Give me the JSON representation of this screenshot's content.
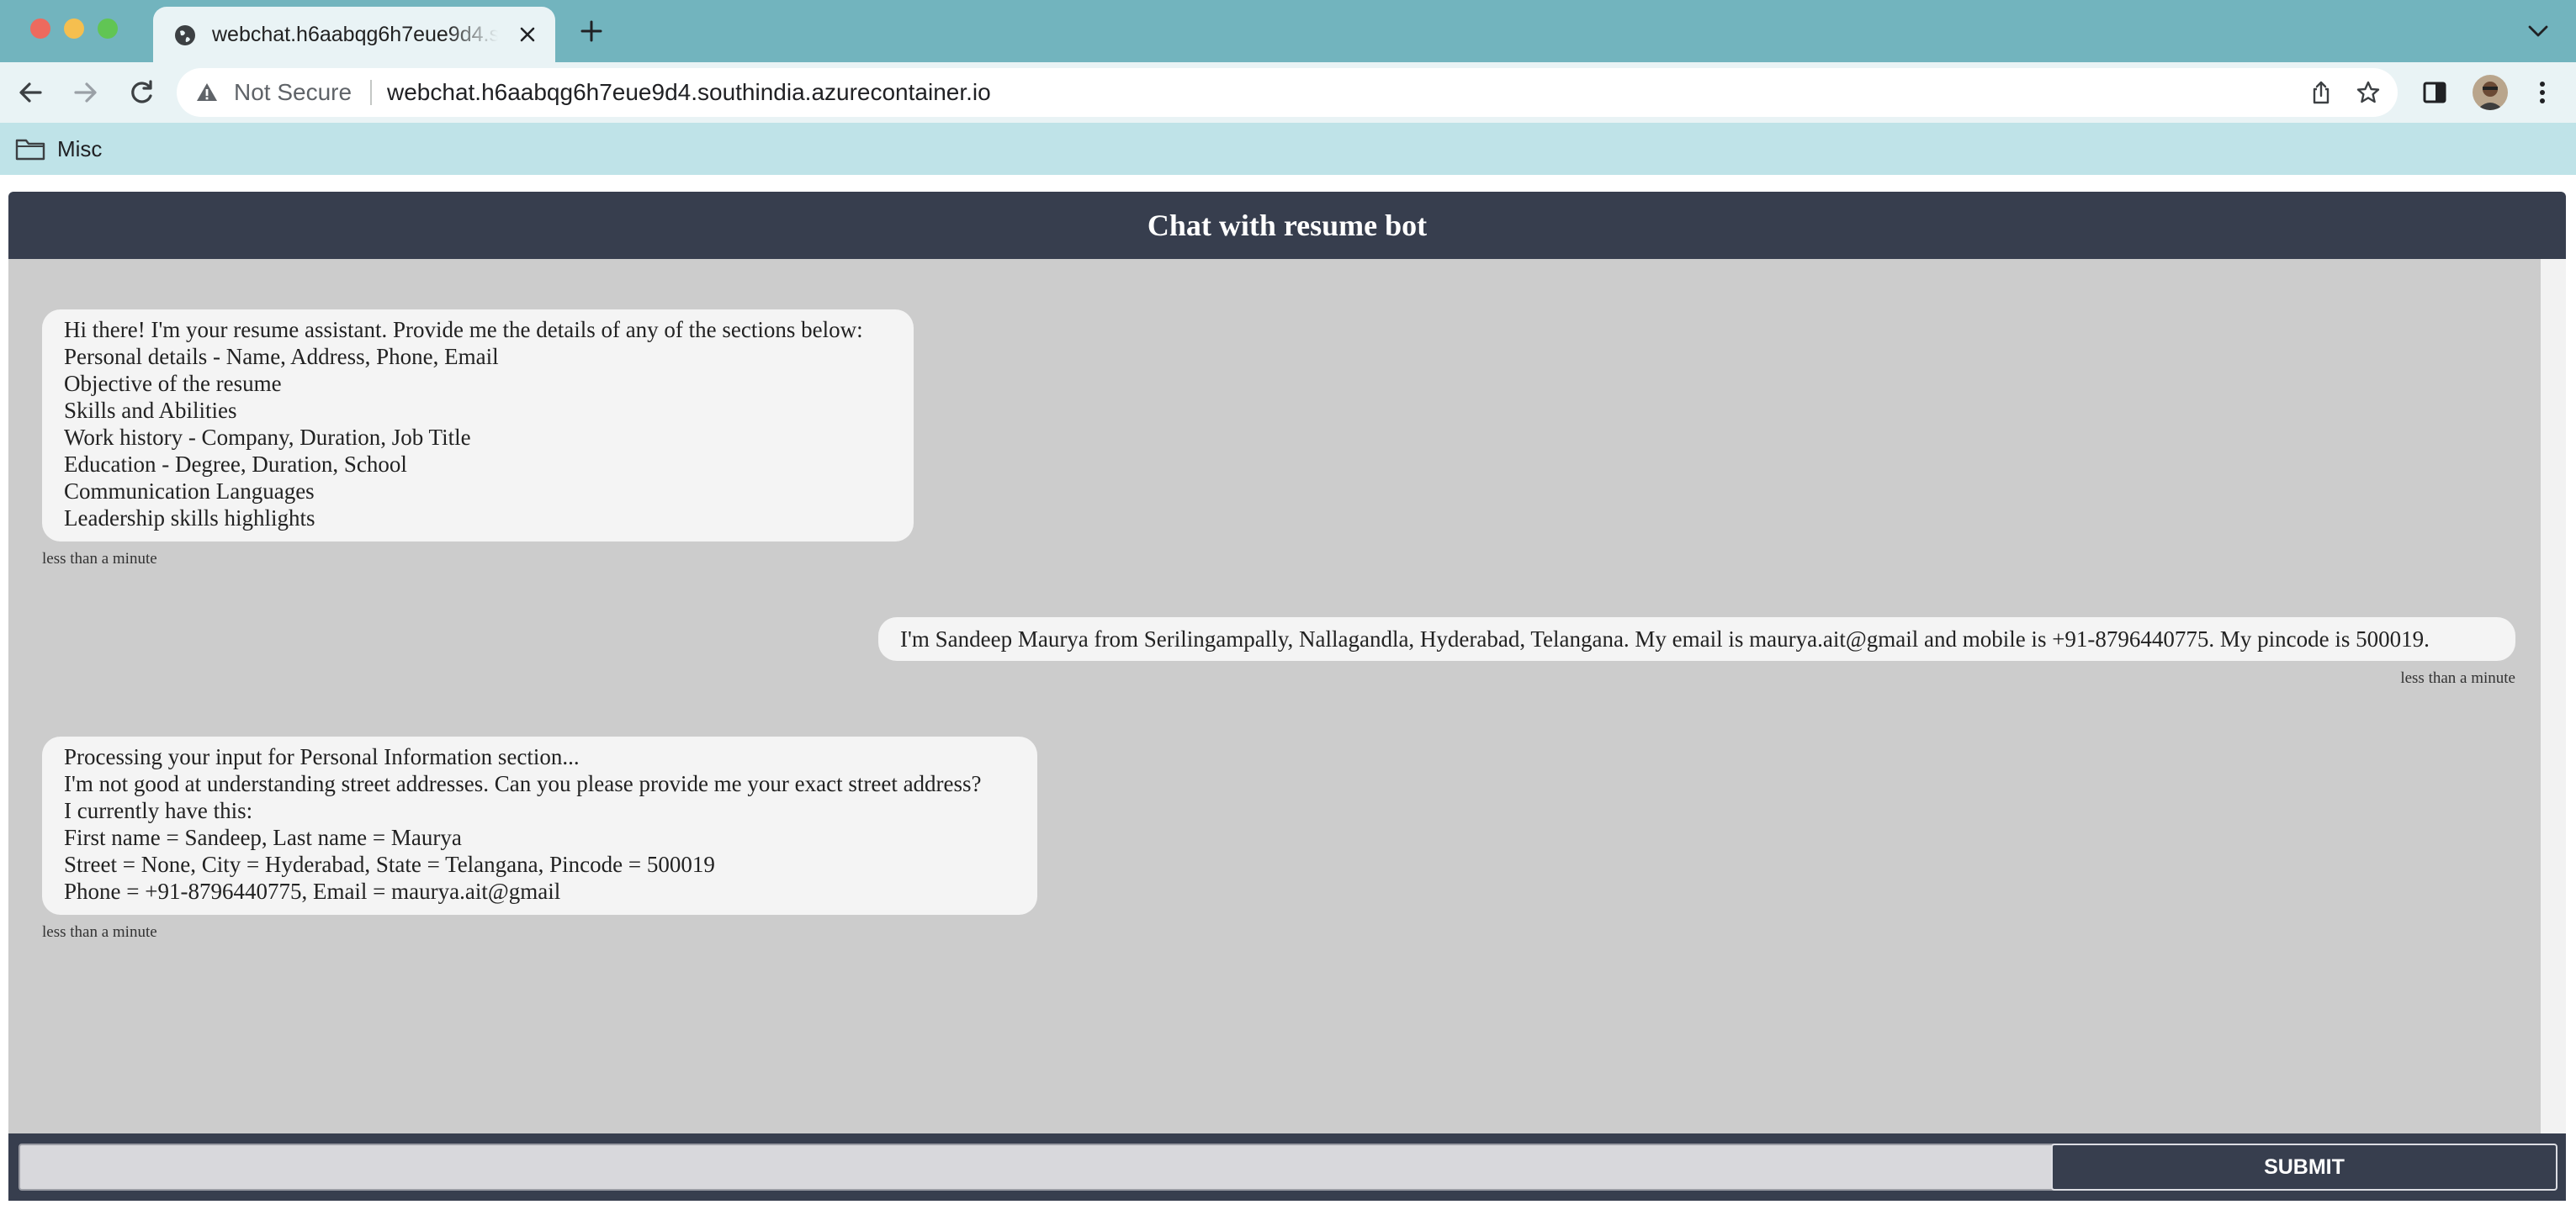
{
  "browser": {
    "tab": {
      "title": "webchat.h6aabqg6h7eue9d4.southindia.azurecontainer.io",
      "favicon": "globe-icon"
    },
    "address_bar": {
      "security_label": "Not Secure",
      "url": "webchat.h6aabqg6h7eue9d4.southindia.azurecontainer.io"
    },
    "bookmarks": [
      {
        "label": "Misc",
        "icon": "folder-icon"
      }
    ],
    "colors": {
      "tabbar": "#72b4be",
      "toolbar": "#e9f3f5",
      "bookmarks_bar": "#bfe3e8"
    }
  },
  "chat": {
    "title": "Chat with resume bot",
    "messages": [
      {
        "sender": "bot",
        "lines": [
          "Hi there! I'm your resume assistant. Provide me the details of any of the sections below:",
          "Personal details - Name, Address, Phone, Email",
          "Objective of the resume",
          "Skills and Abilities",
          "Work history - Company, Duration, Job Title",
          "Education - Degree, Duration, School",
          "Communication Languages",
          "Leadership skills highlights"
        ],
        "time": "less than a minute"
      },
      {
        "sender": "user",
        "lines": [
          "I'm Sandeep Maurya from Serilingampally, Nallagandla, Hyderabad, Telangana. My email is maurya.ait@gmail and mobile is +91-8796440775. My pincode is 500019."
        ],
        "time": "less than a minute"
      },
      {
        "sender": "bot",
        "lines": [
          "Processing your input for Personal Information section...",
          "I'm not good at understanding street addresses. Can you please provide me your exact street address?",
          "I currently have this:",
          "First name = Sandeep, Last name = Maurya",
          "Street = None, City = Hyderabad, State = Telangana, Pincode = 500019",
          "Phone = +91-8796440775, Email = maurya.ait@gmail"
        ],
        "time": "less than a minute"
      }
    ],
    "input": {
      "value": "",
      "placeholder": ""
    },
    "submit_label": "SUBMIT",
    "colors": {
      "header": "#373e4e",
      "chat_background": "#cccccc",
      "bubble": "#f4f4f4"
    }
  }
}
